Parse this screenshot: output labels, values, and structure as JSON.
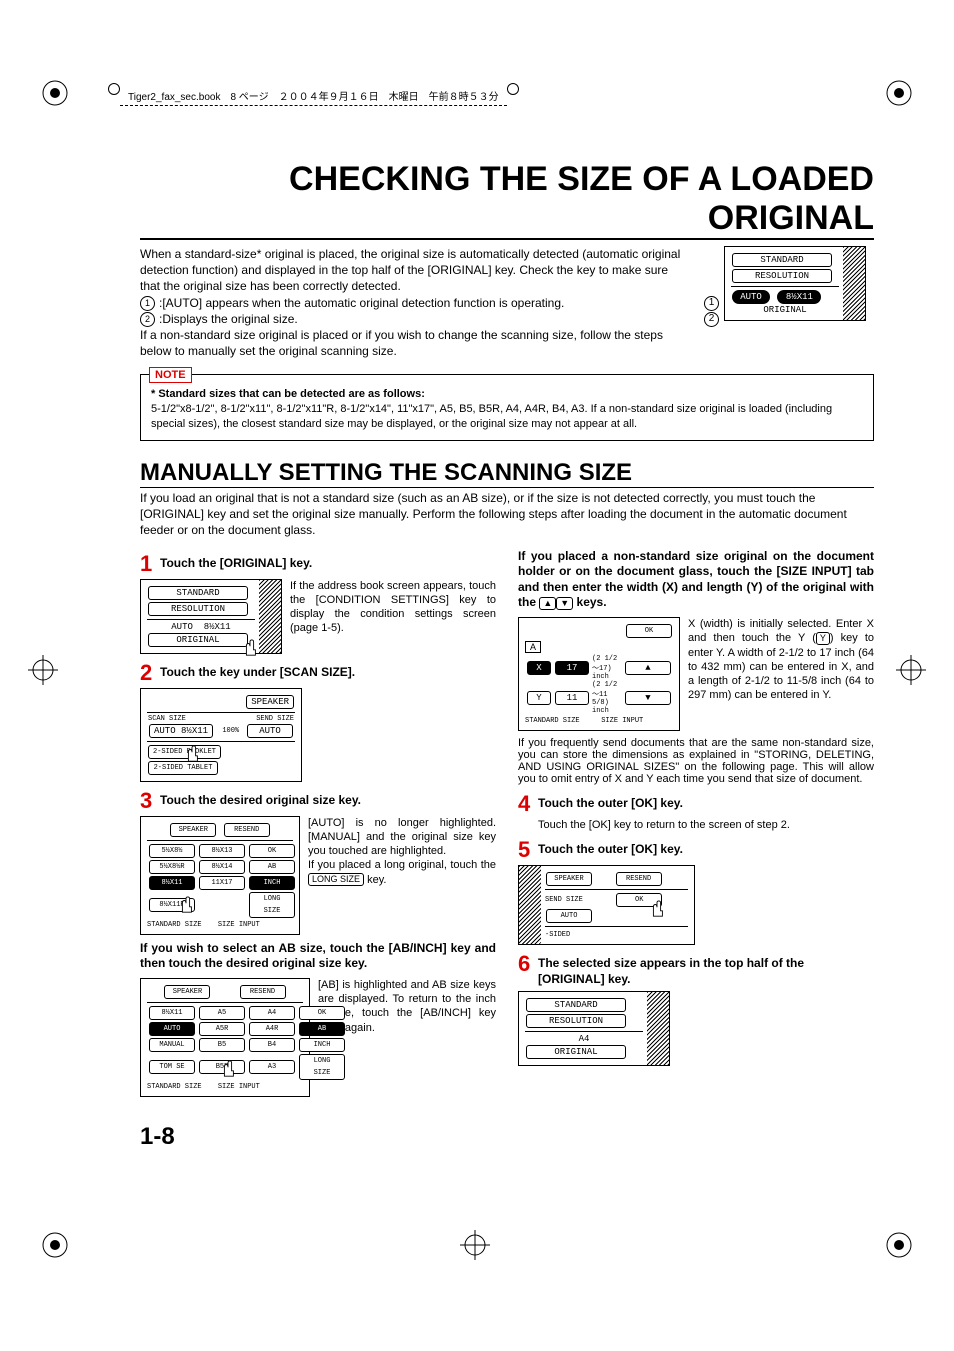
{
  "meta_header": "Tiger2_fax_sec.book　8 ページ　２００４年９月１６日　木曜日　午前８時５３分",
  "main_title": "CHECKING THE SIZE OF A LOADED ORIGINAL",
  "intro_p1": "When a standard-size* original is placed, the original size is automatically detected (automatic original detection function) and displayed in the top half of the [ORIGINAL] key. Check the key to make sure that the original size has been correctly detected.",
  "intro_li1": ":[AUTO] appears when the automatic original detection function is operating.",
  "intro_li2": ":Displays the original size.",
  "intro_p2": "If a non-standard size original is placed or if you wish to change the scanning size, follow the steps below to manually set the original scanning size.",
  "circ1": "1",
  "circ2": "2",
  "note_label": "NOTE",
  "note_bold": "* Standard sizes that can be detected are as follows:",
  "note_body": "5-1/2\"x8-1/2\", 8-1/2\"x11\", 8-1/2\"x11\"R, 8-1/2\"x14\", 11\"x17\", A5, B5, B5R, A4, A4R, B4, A3. If a non-standard size original is loaded (including special sizes), the closest standard size may be displayed, or the original size may not appear at all.",
  "sub_title": "MANUALLY SETTING THE SCANNING SIZE",
  "sub_intro": "If you load an original that is not a standard size (such as an AB size), or if the size is not detected correctly, you must touch the [ORIGINAL] key and set the original size manually. Perform the following steps after loading the document in the automatic document feeder or on the document glass.",
  "steps": {
    "s1_title": "Touch the [ORIGINAL] key.",
    "s1_desc": "If the address book screen appears, touch the [CONDITION SETTINGS] key to display the condition settings screen (page 1-5).",
    "s2_title": "Touch the key under [SCAN SIZE].",
    "s3_title": "Touch the desired original size key.",
    "s3_desc1": "[AUTO] is no longer highlighted. [MANUAL] and the original size key you touched are highlighted.",
    "s3_desc2_a": "If you placed a long original, touch the ",
    "s3_desc2_b": " key.",
    "s3_long_size_btn": "LONG SIZE",
    "ab_bold": "If you wish to select an AB size, touch the [AB/INCH] key and then touch the desired original size key.",
    "ab_desc": "[AB] is highlighted and AB size keys are displayed. To return to the inch palette, touch the [AB/INCH] key once again.",
    "r_bold": "If you placed a non-standard size original on the document holder or on the document glass, touch the [SIZE INPUT] tab and then enter the width (X) and length (Y) of the original with the ",
    "r_bold_b": " keys.",
    "r_desc1": "X (width) is initially selected. Enter X and then touch the Y (",
    "r_desc1_y": "Y",
    "r_desc1_b": ") key to enter Y. A width of 2-1/2 to 17 inch (64 to 432 mm) can be entered in X, and a length of 2-1/2 to 11-5/8 inch (64 to 297 mm) can be entered in Y.",
    "r_desc2": "If you frequently send documents that are the same non-standard size, you can store the dimensions as explained in \"STORING, DELETING, AND USING ORIGINAL SIZES\" on the following page. This will allow you to omit entry of X and Y each time you send that size of document.",
    "s4_title": "Touch the outer [OK] key.",
    "s4_desc": "Touch the [OK] key to return to the screen of step 2.",
    "s5_title": "Touch the outer [OK] key.",
    "s6_title": "The selected size appears in the top half of the [ORIGINAL] key."
  },
  "lcd": {
    "standard": "STANDARD",
    "resolution": "RESOLUTION",
    "auto": "AUTO",
    "size_8x11": "8½X11",
    "original": "ORIGINAL",
    "speaker": "SPEAKER",
    "scan_size": "SCAN SIZE",
    "send_size": "SEND SIZE",
    "hundred": "100%",
    "two_sided_booklet": "2-SIDED BOOKLET",
    "two_sided_tablet": "2-SIDED TABLET",
    "resend": "RESEND",
    "ok": "OK",
    "sizes": {
      "a": "5½X8½",
      "b": "8½X13",
      "c": "5½X8½R",
      "d": "8½X14",
      "e": "8½X11",
      "f": "11X17",
      "g": "8½X11R"
    },
    "ab": "AB",
    "inch": "INCH",
    "long_size": "LONG SIZE",
    "standard_size": "STANDARD SIZE",
    "size_input": "SIZE INPUT",
    "ab_sizes": {
      "r1c1": "8½X11",
      "r1c2": "A5",
      "r1c3": "A4",
      "r2c1": "AUTO",
      "r2c2": "A5R",
      "r2c3": "A4R",
      "r3c1": "MANUAL",
      "r3c2": "B5",
      "r3c3": "B4",
      "r4c1": "TOM SE",
      "r4c2": "B5R",
      "r4c3": "A3"
    },
    "x": "X",
    "y": "Y",
    "xval": "17",
    "yval": "11",
    "xrange": "(2 1/2～17) inch",
    "yrange": "(2 1/2～11 5/8) inch",
    "minus_sided": "-SIDED",
    "a4": "A4",
    "sp_speaker": "SPEAKER"
  },
  "page_num": "1-8"
}
